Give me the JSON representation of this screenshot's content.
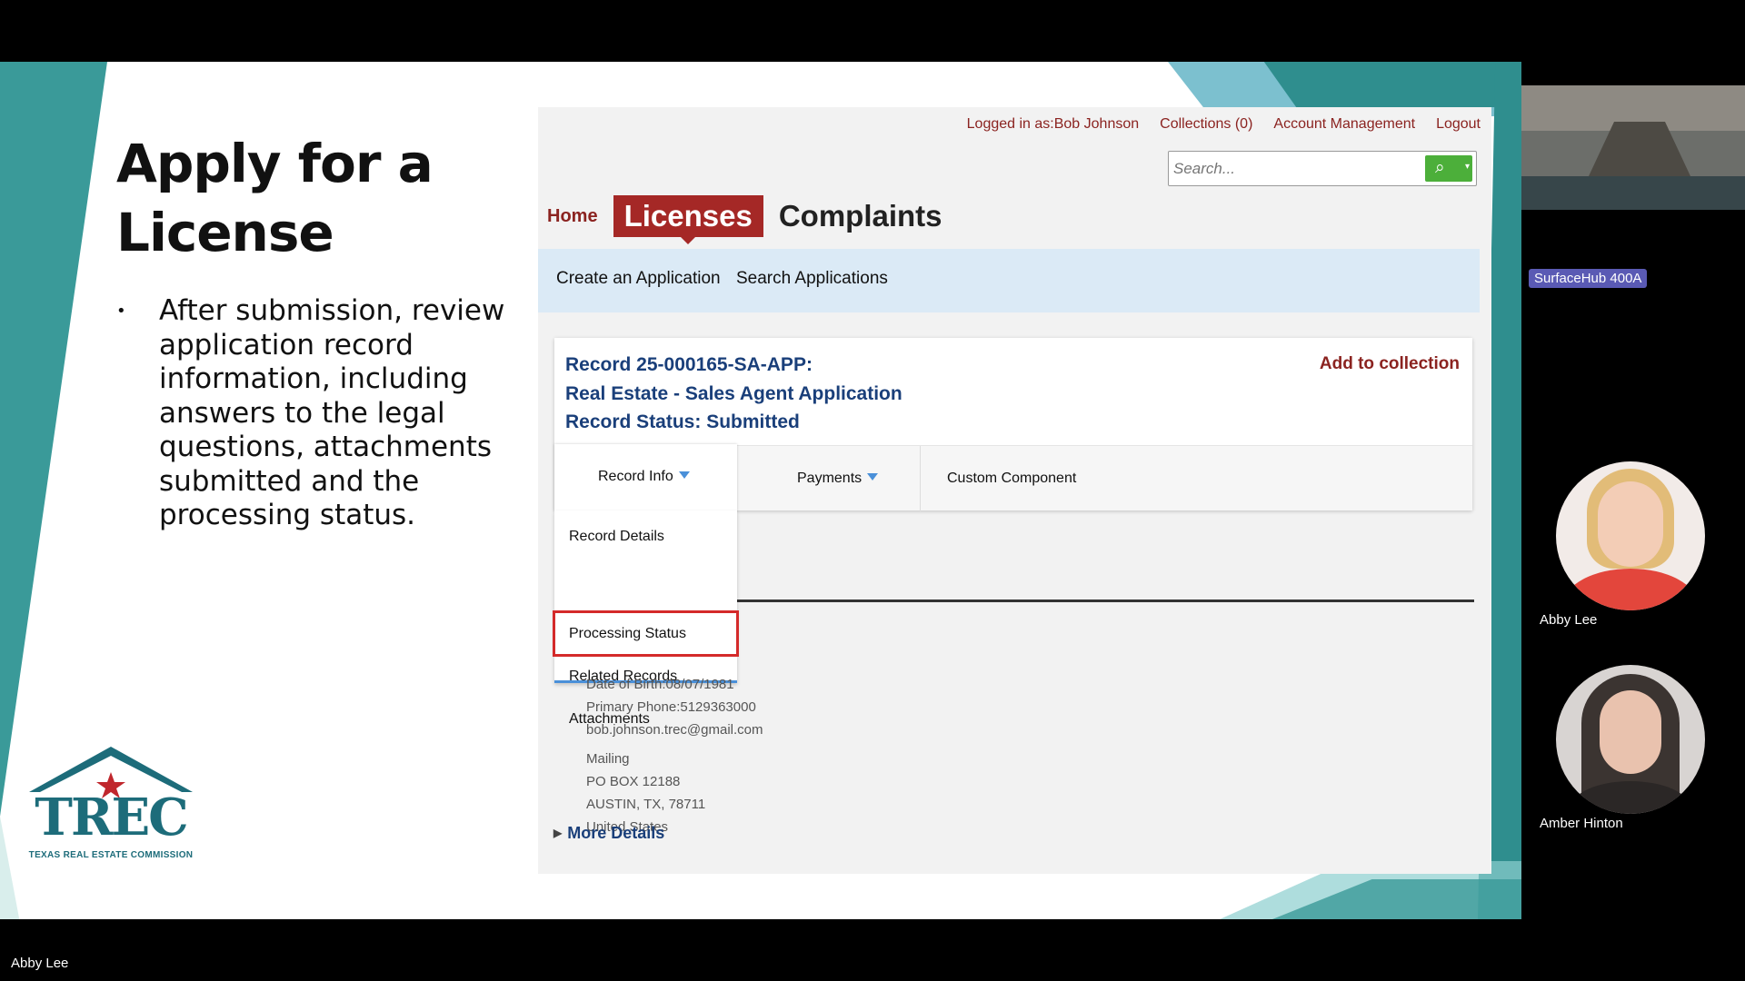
{
  "slide": {
    "title": "Apply for a License",
    "bullet": "After submission, review application record information, including answers to the legal questions, attachments submitted and the processing status.",
    "bullet_marker": "•",
    "logo_text": "TREC",
    "logo_subtitle": "TEXAS REAL ESTATE COMMISSION",
    "accent_color": "#3a9a99"
  },
  "web": {
    "top_links": {
      "logged_in": "Logged in as:Bob Johnson",
      "collections": "Collections (0)",
      "account": "Account Management",
      "logout": "Logout"
    },
    "search": {
      "placeholder": "Search...",
      "icon": "search-icon"
    },
    "nav": {
      "home": "Home",
      "licenses": "Licenses",
      "complaints": "Complaints"
    },
    "subnav": {
      "create": "Create an Application",
      "search": "Search Applications"
    },
    "record": {
      "line1": "Record 25-000165-SA-APP:",
      "line2": "Real Estate - Sales Agent Application",
      "line3": "Record Status: Submitted",
      "add_to_collection": "Add to collection"
    },
    "tabs": {
      "record_info": "Record Info",
      "payments": "Payments",
      "custom": "Custom Component"
    },
    "dropdown": {
      "items": [
        "Record Details",
        "Processing Status",
        "Related Records",
        "Attachments"
      ],
      "highlighted": "Processing Status"
    },
    "details": {
      "dob": "Date of Birth:08/07/1981",
      "phone": "Primary Phone:5129363000",
      "email": "bob.johnson.trec@gmail.com",
      "mailing_label": "Mailing",
      "address1": "PO BOX 12188",
      "address2": "AUSTIN, TX, 78711",
      "country": "United States"
    },
    "more_details": "More Details",
    "colors": {
      "brand_red": "#a52826",
      "link_red": "#8b2320",
      "record_blue": "#1a3f7a",
      "highlight_border": "#d42a2a"
    }
  },
  "meeting": {
    "room_label": "SurfaceHub 400A",
    "participants": [
      "Abby Lee",
      "Amber Hinton"
    ],
    "presenter_name": "Abby Lee"
  }
}
